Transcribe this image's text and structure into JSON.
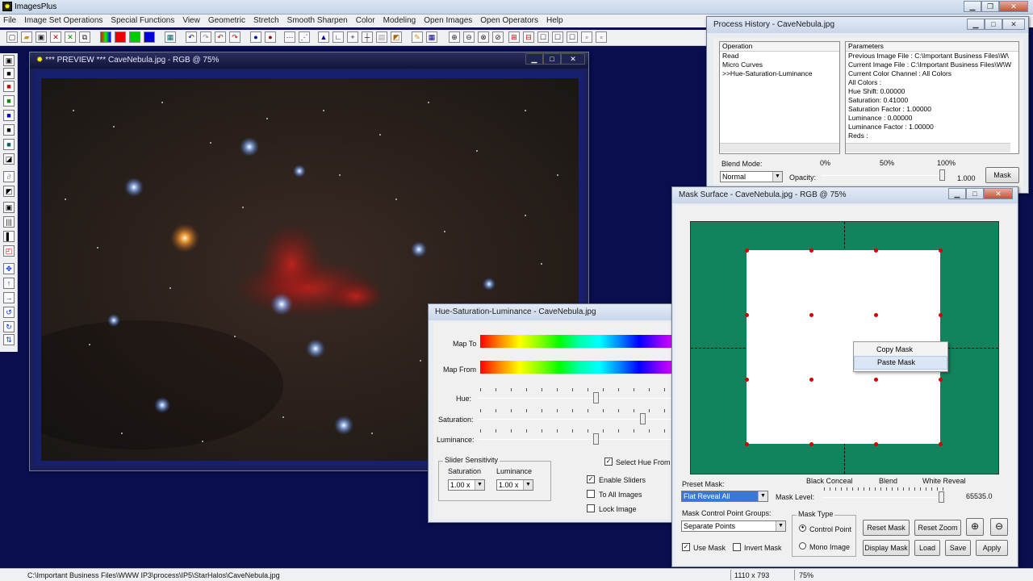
{
  "app": {
    "title": "ImagesPlus"
  },
  "menu": [
    "File",
    "Image Set Operations",
    "Special Functions",
    "View",
    "Geometric",
    "Stretch",
    "Smooth Sharpen",
    "Color",
    "Modeling",
    "Open Images",
    "Open Operators",
    "Help"
  ],
  "preview": {
    "title": "*** PREVIEW *** CaveNebula.jpg - RGB @ 75%"
  },
  "history": {
    "title": "Process History - CaveNebula.jpg",
    "op_header": "Operation",
    "param_header": "Parameters",
    "operations": [
      "Read",
      "Micro Curves",
      ">>Hue-Saturation-Luminance"
    ],
    "parameters": [
      "Previous Image File : C:\\Important Business Files\\W\\",
      "Current Image File : C:\\Important Business Files\\W\\W",
      "Current Color Channel : All Colors",
      "All Colors :",
      "Hue Shift: 0.00000",
      "Saturation: 0.41000",
      "Saturation Factor : 1.00000",
      "Luminance : 0.00000",
      "Luminance Factor : 1.00000",
      "Reds :"
    ],
    "blend_label": "Blend Mode:",
    "blend_value": "Normal",
    "opacity_label": "Opacity:",
    "pct0": "0%",
    "pct50": "50%",
    "pct100": "100%",
    "opacity_value": "1.000",
    "mask_button": "Mask"
  },
  "hsl": {
    "title": "Hue-Saturation-Luminance - CaveNebula.jpg",
    "map_to": "Map To",
    "map_from": "Map From",
    "hue": "Hue:",
    "saturation": "Saturation:",
    "luminance": "Luminance:",
    "group_title": "Slider Sensitivity",
    "sat_col": "Saturation",
    "lum_col": "Luminance",
    "sat_val": "1.00 x",
    "lum_val": "1.00 x",
    "select_hue": "Select Hue From I",
    "enable_sliders": "Enable Sliders",
    "to_all_images": "To All Images",
    "lock_image": "Lock Image"
  },
  "mask": {
    "title": "Mask Surface - CaveNebula.jpg - RGB @ 75%",
    "preset_label": "Preset Mask:",
    "preset_value": "Flat Reveal All",
    "black_conceal": "Black Conceal",
    "blend": "Blend",
    "white_reveal": "White Reveal",
    "level_label": "Mask Level:",
    "level_value": "65535.0",
    "groups_label": "Mask Control Point Groups:",
    "groups_value": "Separate Points",
    "type_label": "Mask Type",
    "control_point": "Control Point",
    "mono_image": "Mono Image",
    "reset_mask": "Reset Mask",
    "reset_zoom": "Reset Zoom",
    "use_mask": "Use Mask",
    "invert_mask": "Invert Mask",
    "display_mask": "Display Mask",
    "load": "Load",
    "save": "Save",
    "apply": "Apply",
    "context_menu": [
      "Copy Mask",
      "Paste Mask"
    ]
  },
  "status": {
    "path": "C:\\Important Business Files\\WWW IP3\\process\\IP5\\StarHalos\\CaveNebula.jpg",
    "size": "1110 x 793",
    "zoom": "75%"
  }
}
